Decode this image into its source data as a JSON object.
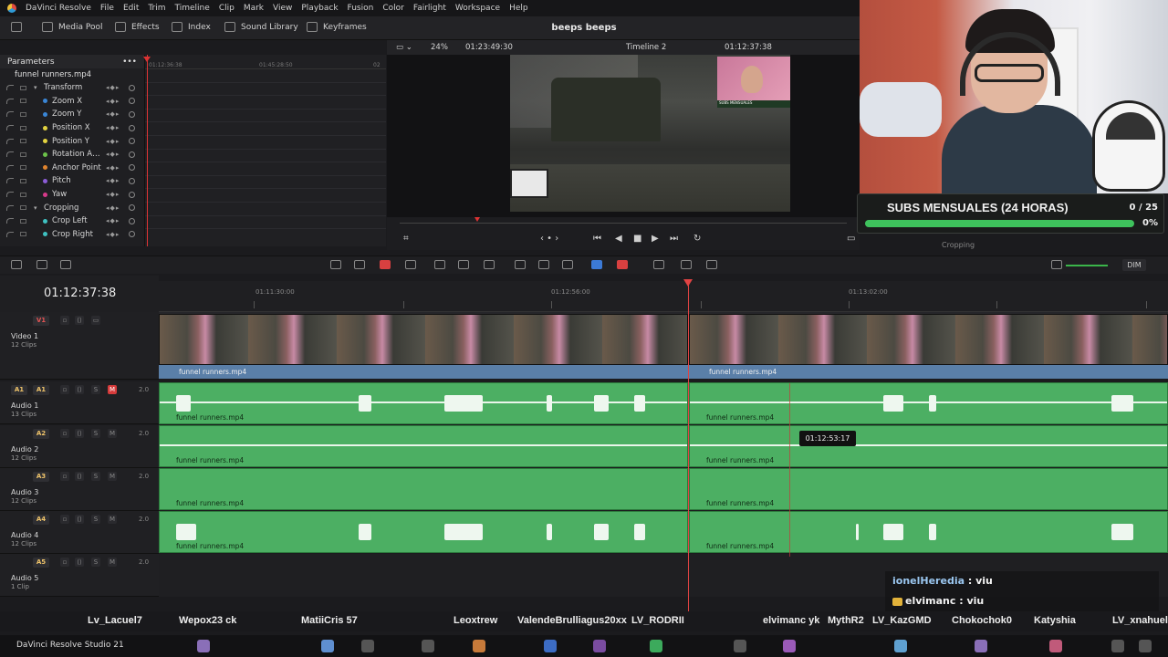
{
  "menu": [
    "DaVinci Resolve",
    "File",
    "Edit",
    "Trim",
    "Timeline",
    "Clip",
    "Mark",
    "View",
    "Playback",
    "Fusion",
    "Color",
    "Fairlight",
    "Workspace",
    "Help"
  ],
  "toolbar": {
    "media_pool": "Media Pool",
    "effects": "Effects",
    "index": "Index",
    "sound_library": "Sound Library",
    "keyframes": "Keyframes",
    "project_title": "beeps beeps"
  },
  "inspector": {
    "header": "Parameters",
    "clip": "funnel runners.mp4",
    "params": [
      {
        "label": "Transform",
        "group": true,
        "color": ""
      },
      {
        "label": "Zoom X",
        "group": false,
        "color": "#3a86d6"
      },
      {
        "label": "Zoom Y",
        "group": false,
        "color": "#3a86d6"
      },
      {
        "label": "Position X",
        "group": false,
        "color": "#e3d340"
      },
      {
        "label": "Position Y",
        "group": false,
        "color": "#e3d340"
      },
      {
        "label": "Rotation An...",
        "group": false,
        "color": "#6cc24a"
      },
      {
        "label": "Anchor Point",
        "group": false,
        "color": "#e0842e"
      },
      {
        "label": "Pitch",
        "group": false,
        "color": "#8b5cd6"
      },
      {
        "label": "Yaw",
        "group": false,
        "color": "#d63a8a"
      },
      {
        "label": "Cropping",
        "group": true,
        "color": ""
      },
      {
        "label": "Crop Left",
        "group": false,
        "color": "#3fc1c1"
      },
      {
        "label": "Crop Right",
        "group": false,
        "color": "#3fc1c1"
      }
    ]
  },
  "keyframe_ruler": [
    "01:12:36:38",
    "01:45:28:50",
    "02"
  ],
  "viewer": {
    "zoom": "24%",
    "source_tc": "01:23:49:30",
    "timeline_name": "Timeline 2",
    "record_tc": "01:12:37:38",
    "mini_banner": "SUBS MENSUALES"
  },
  "overlay": {
    "subs_title": "SUBS MENSUALES (24 HORAS)",
    "subs_count": "0 / 25",
    "subs_pct": "0%",
    "subs_fraction": 0,
    "cropping_ghost": "Cropping"
  },
  "edit_tools": {
    "dim": "DIM"
  },
  "timeline": {
    "timecode": "01:12:37:38",
    "ruler_labels": [
      "01:11:30:00",
      "01:12:56:00",
      "01:13:02:00"
    ],
    "clip_name": "funnel runners.mp4",
    "hover_tc": "01:12:53:17",
    "tracks": [
      {
        "tag": "V1",
        "name": "Video 1",
        "clips": "12 Clips",
        "vol": ""
      },
      {
        "tag": "A1",
        "name": "Audio 1",
        "clips": "13 Clips",
        "vol": "2.0"
      },
      {
        "tag": "A2",
        "name": "Audio 2",
        "clips": "12 Clips",
        "vol": "2.0"
      },
      {
        "tag": "A3",
        "name": "Audio 3",
        "clips": "12 Clips",
        "vol": "2.0"
      },
      {
        "tag": "A4",
        "name": "Audio 4",
        "clips": "12 Clips",
        "vol": "2.0"
      },
      {
        "tag": "A5",
        "name": "Audio 5",
        "clips": "1 Clip",
        "vol": "2.0"
      }
    ]
  },
  "chat": [
    {
      "user": "ionelHeredia",
      "text": " : viu"
    },
    {
      "user": "elvimanc",
      "text": " : viu"
    }
  ],
  "viewers": [
    "Lv_Lacuel7",
    "Wepox23 ck",
    "MatiiCris 57",
    "Leoxtrew",
    "ValendeBrulliagus20xx",
    "LV_RODRII",
    "elvimanc yk",
    "MythR2",
    "LV_KazGMD",
    "Chokochok0",
    "Katyshia",
    "LV_xnahuel"
  ],
  "taskbar": {
    "app": "DaVinci Resolve Studio 21"
  }
}
